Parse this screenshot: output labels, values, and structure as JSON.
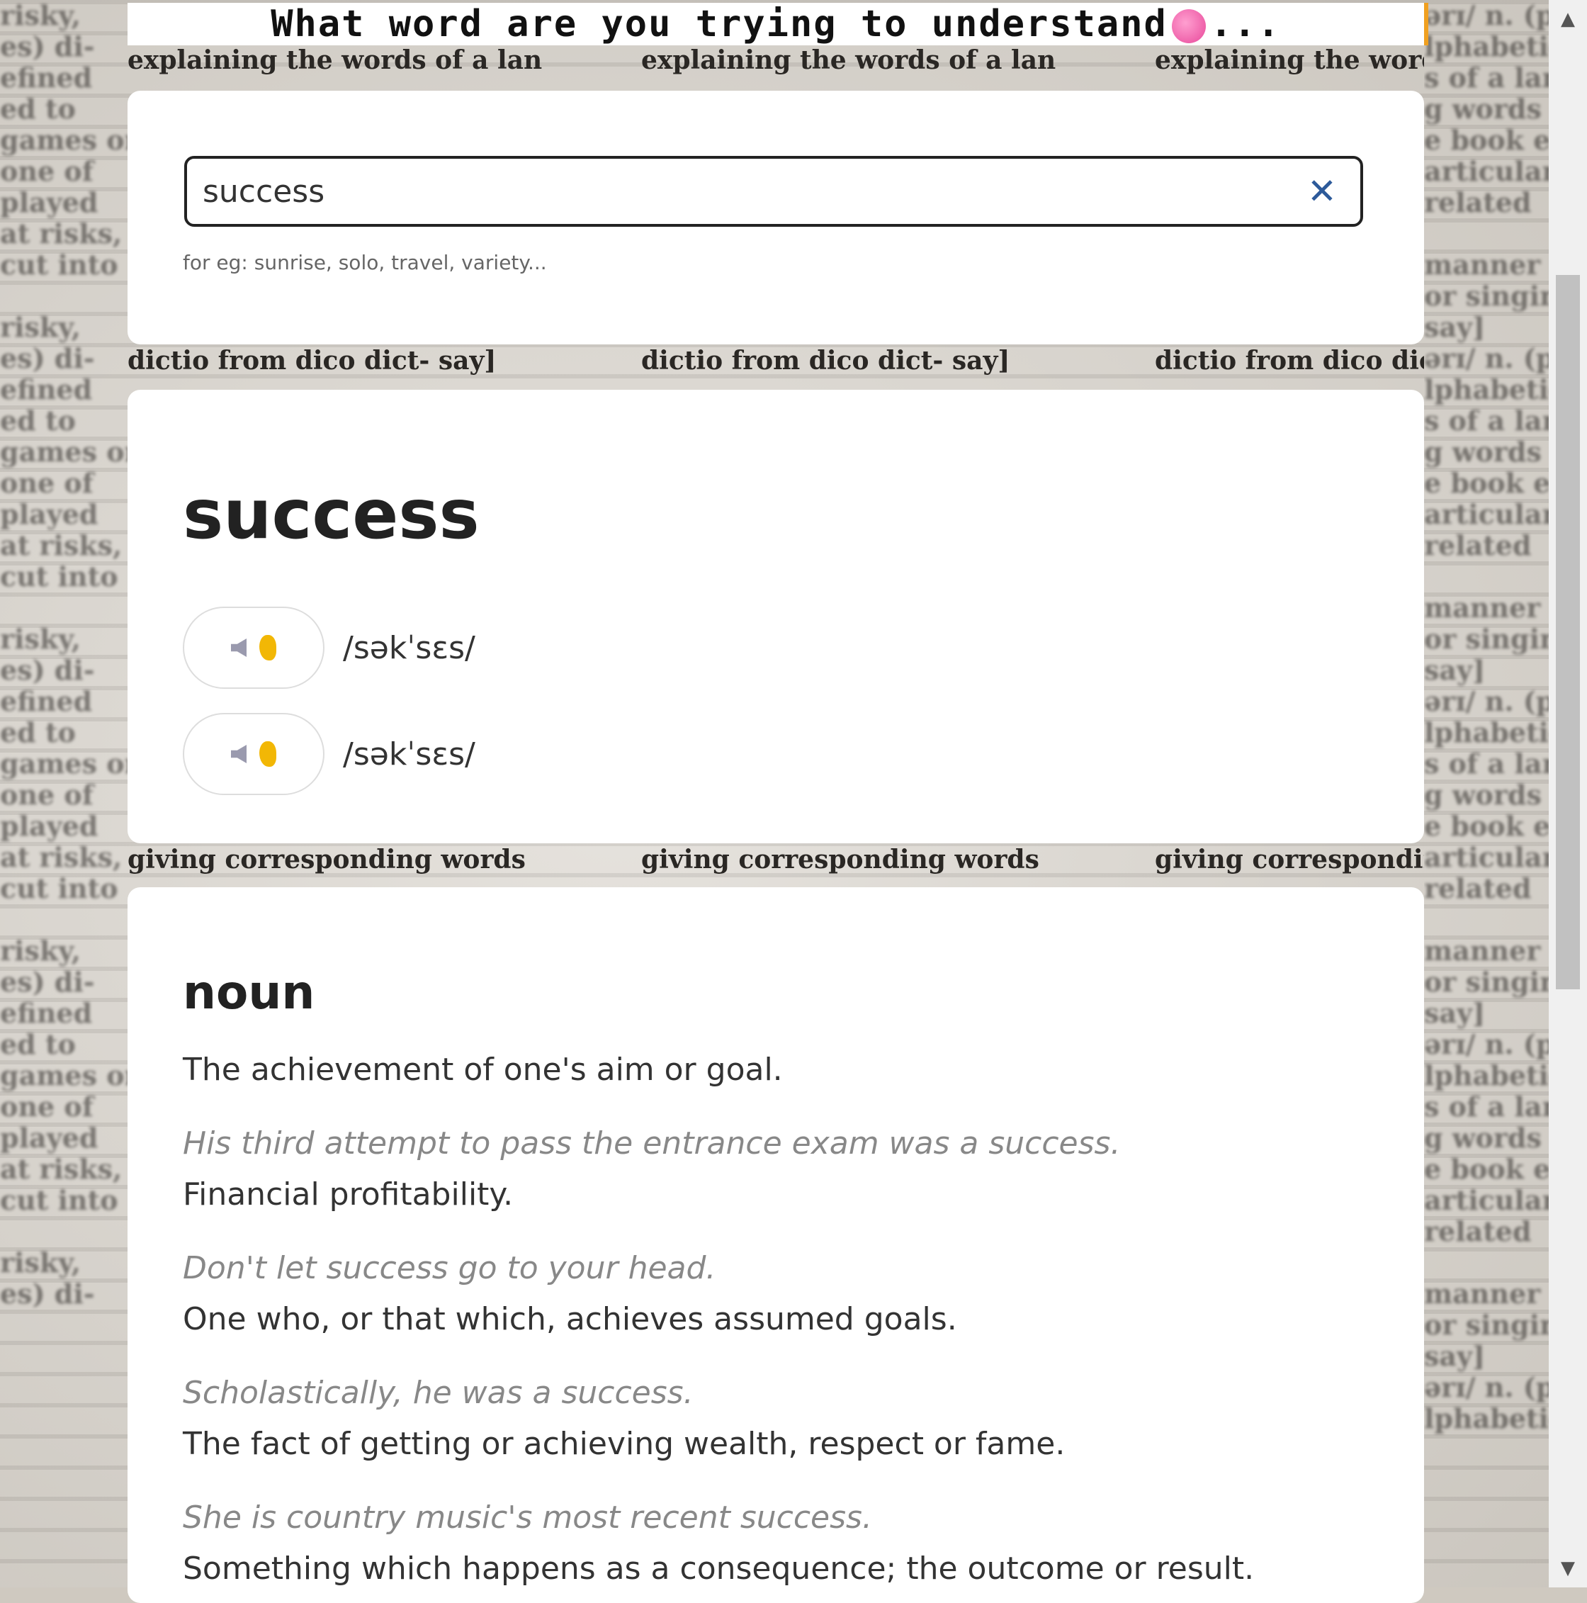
{
  "header": {
    "title_before": "What word are you trying to understand",
    "title_after": "..."
  },
  "search": {
    "value": "success",
    "clear_label": "✕",
    "hint": "for eg: sunrise, solo, travel, variety..."
  },
  "word": {
    "title": "success",
    "phonetics": [
      {
        "text": "/səkˈsɛs/"
      },
      {
        "text": "/səkˈsɛs/"
      }
    ]
  },
  "meaning": {
    "part_of_speech": "noun",
    "definitions": [
      {
        "definition": "The achievement of one's aim or goal.",
        "example": "His third attempt to pass the entrance exam was a success."
      },
      {
        "definition": "Financial profitability.",
        "example": "Don't let success go to your head."
      },
      {
        "definition": "One who, or that which, achieves assumed goals.",
        "example": "Scholastically, he was a success."
      },
      {
        "definition": "The fact of getting or achieving wealth, respect or fame.",
        "example": "She is country music's most recent success."
      },
      {
        "definition": "Something which happens as a consequence; the outcome or result.",
        "example": ""
      }
    ]
  },
  "colors": {
    "accent": "#2d5a9a",
    "brain": "#e8489a",
    "ear": "#f2b705",
    "header_border": "#f0a020"
  },
  "icons": {
    "clear": "close-icon",
    "speaker": "speaker-icon",
    "ear": "ear-icon",
    "brain": "brain-icon"
  }
}
